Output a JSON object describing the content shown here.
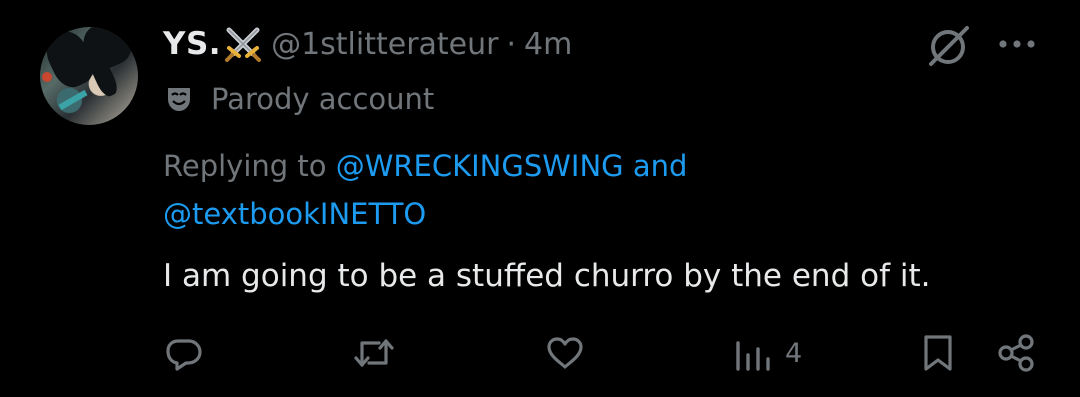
{
  "author": {
    "name": "YS.",
    "handle": "@1stlitterateur",
    "separator": "·",
    "time": "4m",
    "label": "Parody account",
    "name_emoji": "crossed-swords"
  },
  "reply": {
    "prefix": "Replying to",
    "mention_1": "@WRECKINGSWING",
    "joiner": "and",
    "mention_2": "@textbookINETTO"
  },
  "tweet": {
    "text": "I am going to be a stuffed churro by the end of it."
  },
  "actions": {
    "views_count": "4"
  },
  "icons": {
    "grok": "grok-icon",
    "more": "more-options-icon",
    "reply": "reply-icon",
    "retweet": "retweet-icon",
    "like": "like-icon",
    "views": "views-icon",
    "bookmark": "bookmark-icon",
    "share": "share-icon",
    "parody": "theater-mask-icon"
  },
  "colors": {
    "background": "#000000",
    "text": "#e7e9ea",
    "muted": "#71767b",
    "link": "#1d9bf0"
  }
}
